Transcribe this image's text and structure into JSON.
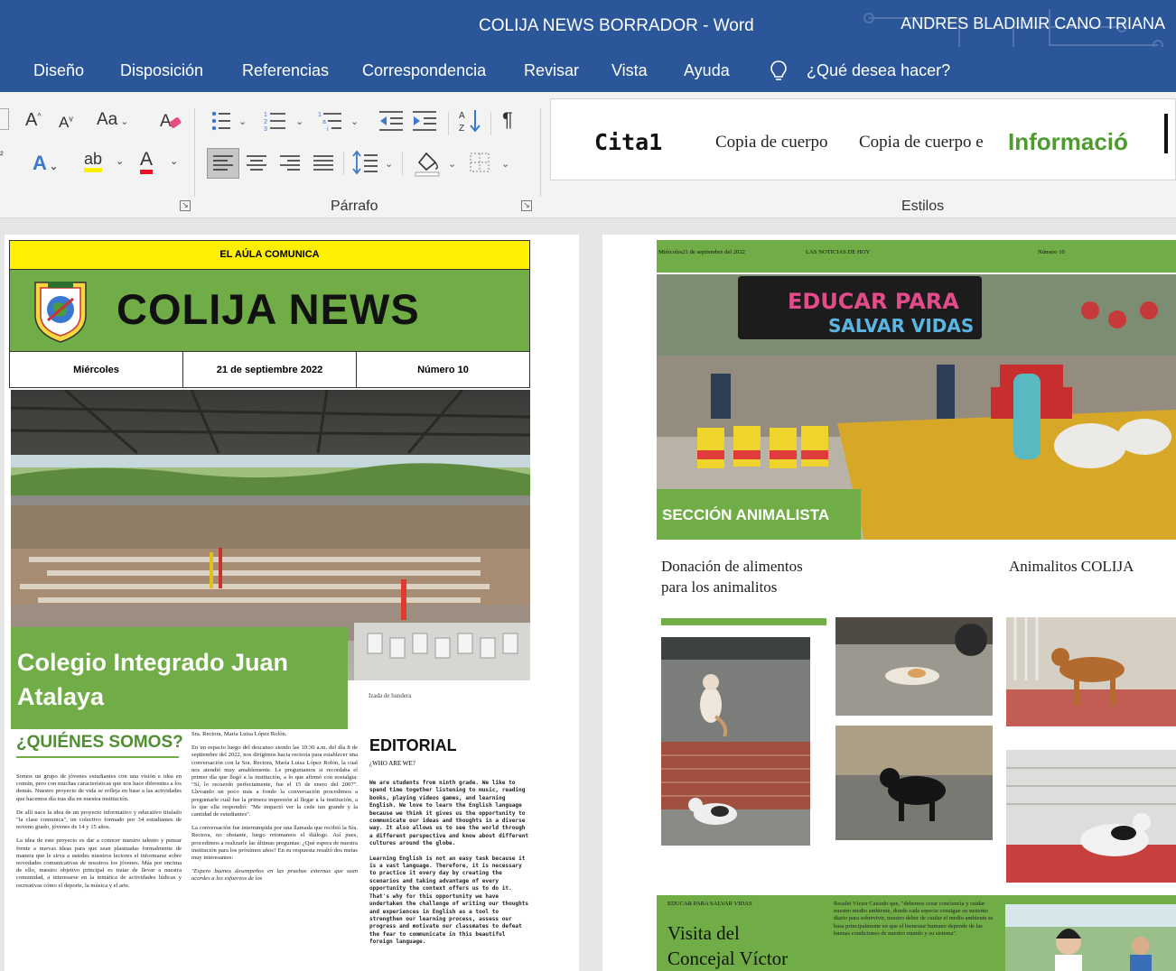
{
  "titlebar": {
    "doc_title": "COLIJA NEWS BORRADOR  -  Word",
    "user_name": "ANDRES BLADIMIR CANO TRIANA"
  },
  "menu": {
    "tabs": [
      "Diseño",
      "Disposición",
      "Referencias",
      "Correspondencia",
      "Revisar",
      "Vista",
      "Ayuda"
    ],
    "tell_me": "¿Qué desea hacer?"
  },
  "ribbon": {
    "font_group": {
      "grow_font": "A",
      "shrink_font": "A",
      "change_case": "Aa",
      "text_effects": "A",
      "highlight": "ab",
      "font_color": "A"
    },
    "paragraph_label": "Párrafo",
    "styles_label": "Estilos",
    "styles": [
      {
        "name": "Cita1",
        "color": "#111111"
      },
      {
        "name": "Copia de cuerpo",
        "color": "#222222"
      },
      {
        "name": "Copia de cuerpo e",
        "color": "#222222"
      },
      {
        "name": "Informació",
        "color": "#4f9a2f"
      }
    ]
  },
  "left_page": {
    "tagline": "EL AÚLA COMUNICA",
    "masthead": "COLIJA NEWS",
    "date_row": [
      "Miércoles",
      "21 de septiembre 2022",
      "Número 10"
    ],
    "hero_caption_line1": "Colegio Integrado Juan",
    "hero_caption_line2": "Atalaya",
    "image_caption": "Izada de bandera",
    "quienes_heading": "¿QUIÉNES SOMOS?",
    "quienes_paragraphs": [
      "Somos un grupo de jóvenes estudiantes con una visión e idea en común, pero con muchas características que nos hace diferentes a los demás. Nuestro proyecto de vida se refleja en base a las actividades que hacemos día tras día en nuestra institución.",
      "De allí nace la idea de un proyecto informativo y educativo titulado \"la clase comunica\", un colectivo formado por 34 estudiantes de noveno grado, jóvenes de 14 y 15 años.",
      "La idea de este proyecto es dar a conocer nuestro talento y pensar frente a nuevas ideas para que sean plasmadas formalmente de manera que le sirva a ustedes nuestros lectores el informarse sobre novedades comunicativas de nosotros los jóvenes. Más por encima de ello, nuestro objetivo principal es tratar de llevar a nuestra comunidad, a interesarse en la temática de actividades lúdicas y recreativas cómo el deporte, la música y el arte."
    ],
    "middle_paragraphs": [
      "Sra. Rectora, María Luisa López Rolón.",
      "En un espacio luego del descanso siendo las 10:30 a.m. del día 8 de septiembre del 2022, nos dirigimos hacia rectoría para establecer una conversación con la Sra. Rectora, María Luisa López Rolón, la cual nos atendió muy amablemente. Le preguntamos si recordaba el primer día que llegó a la institución, a lo que afirmó con nostalgia: \"Sí, lo recuerdo perfectamente, fue el 15 de enero del 2007\". Llevando un poco más a fondo la conversación procedimos a preguntarle cuál fue la primera impresión al llegar a la institución, a lo que ella respondió: \"Me impactó ver la cede tan grande y la cantidad de estudiantes\".",
      "La conversación fue interrumpida por una llamada que recibió la Sra. Rectora, no obstante, luego retomamos el diálogo. Así pues, procedimos a realizarle las últimas preguntas: ¿Qué espera de nuestra institución para los próximos años? En su respuesta resaltó dos metas muy interesantes:",
      "\"Espero buenos desempeños en las pruebas externas que sean acordes a los esfuerzos de los"
    ],
    "editorial_title": "EDITORIAL",
    "editorial_sub": "¿WHO ARE WE?",
    "editorial_paragraphs": [
      "We are students from ninth grade. We like to spend time together listening to music, reading books, playing videos games, and learning English. We love to learn the English language because we think it gives us the opportunity to communicate our ideas and thoughts in a diverse way. It also allows us to see the world through a different perspective and know about different cultures around the globe.",
      "Learning English is not an easy task because it is a vast language. Therefore, it is necessary to practice it every day by creating the scenarios and taking advantage of every opportunity the context offers us to do it. That's why for this opportunity we have undertaken the challenge of writing our thoughts and experiences in English as a tool to strengthen our learning process, assess our progress and motivate our classmates to defeat the fear to communicate in this beautiful foreign language."
    ]
  },
  "right_page": {
    "header_left": "Miércoles21 de septiembre del 2022",
    "header_mid": "LAS NOTICIAS DE HOY",
    "header_right": "Número 10",
    "section_banner": "SECCIÓN ANIMALISTA",
    "heading_left_line1": "Donación de alimentos",
    "heading_left_line2": "para los animalitos",
    "heading_right": "Animalitos COLIJA",
    "bottom_small": "EDUCAR PARA SALVAR VIDAS",
    "bottom_title_line1": "Visita del",
    "bottom_title_line2": "Concejal Víctor",
    "bottom_text": "Resaltó Víctor Caicedo que, \"debemos crear conciencia y cuidar nuestro medio ambiente, donde cada especie consigue su sustento diario para sobrevivir, nuestro deber de cuidar el medio ambiente se basa principalmente en que el bienestar humano depende de las buenas condiciones de nuestro mundo y su sistema\"."
  },
  "colors": {
    "word_blue": "#2b579a",
    "green": "#70ad47",
    "yellow": "#ffef00"
  }
}
